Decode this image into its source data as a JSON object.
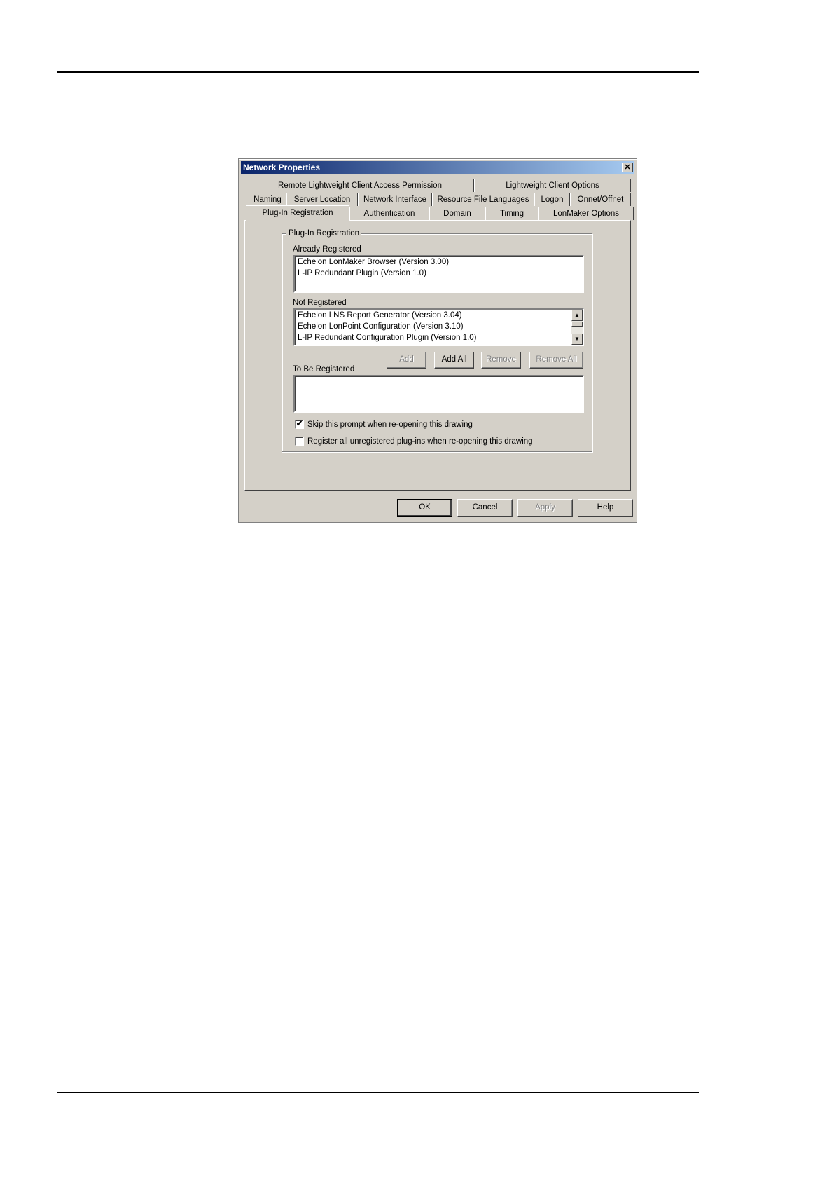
{
  "dialog": {
    "title": "Network Properties",
    "close_glyph": "✕"
  },
  "tabs": {
    "row1": [
      "Remote Lightweight Client Access Permission",
      "Lightweight Client Options"
    ],
    "row2": [
      "Naming",
      "Server Location",
      "Network Interface",
      "Resource File Languages",
      "Logon",
      "Onnet/Offnet"
    ],
    "row3": [
      "Plug-In Registration",
      "Authentication",
      "Domain",
      "Timing",
      "LonMaker Options"
    ],
    "active": "Plug-In Registration"
  },
  "plugin_registration": {
    "group_title": "Plug-In Registration",
    "already_registered_label": "Already Registered",
    "already_registered": [
      "Echelon LonMaker Browser (Version 3.00)",
      "L-IP Redundant Plugin (Version 1.0)"
    ],
    "not_registered_label": "Not Registered",
    "not_registered": [
      "Echelon LNS Report Generator (Version 3.04)",
      "Echelon LonPoint Configuration (Version 3.10)",
      "L-IP Redundant Configuration Plugin (Version 1.0)"
    ],
    "to_be_registered_label": "To Be Registered",
    "to_be_registered": [],
    "buttons": {
      "add": "Add",
      "add_all": "Add All",
      "remove": "Remove",
      "remove_all": "Remove All"
    },
    "skip_prompt_label": "Skip this prompt when re-opening this drawing",
    "skip_prompt_checked": true,
    "register_all_label": "Register all unregistered plug-ins when re-opening this drawing",
    "register_all_checked": false
  },
  "footer": {
    "ok": "OK",
    "cancel": "Cancel",
    "apply": "Apply",
    "help": "Help"
  },
  "icons": {
    "check": "✔",
    "scroll_up": "▲",
    "scroll_down": "▼"
  }
}
